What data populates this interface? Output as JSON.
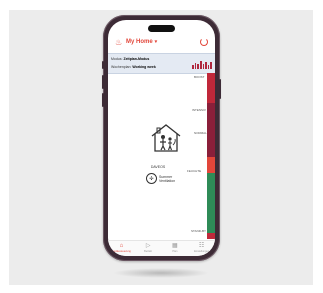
{
  "header": {
    "title": "My Home",
    "chevron": "▾",
    "logo_icon": "flame-logo-icon",
    "power_icon": "power-icon"
  },
  "info": {
    "mode_label": "Modus:",
    "mode_value": "Zeitplan-Modus",
    "week_label": "Wochenplan:",
    "week_value": "Working week"
  },
  "scale": {
    "ticks": [
      "BOOST",
      "INTENSIV",
      "NORMAL",
      "FEUCHTE",
      "STAND-BY"
    ]
  },
  "device": {
    "name": "DAVEOS",
    "mode_line1": "Summer",
    "mode_line2": "Ventilation"
  },
  "nav": {
    "items": [
      {
        "label": "Gerätesteuerung",
        "icon": "home-icon",
        "active": true
      },
      {
        "label": "Betrieb",
        "icon": "play-icon",
        "active": false
      },
      {
        "label": "Plan",
        "icon": "calendar-icon",
        "active": false
      },
      {
        "label": "Einstellungen",
        "icon": "settings-icon",
        "active": false
      }
    ]
  },
  "colors": {
    "accent": "#e2463a",
    "scale_top": "#c0283a",
    "scale_mid": "#8a1f3a",
    "scale_green": "#2e8b57",
    "infobar": "#e4eaf3"
  }
}
